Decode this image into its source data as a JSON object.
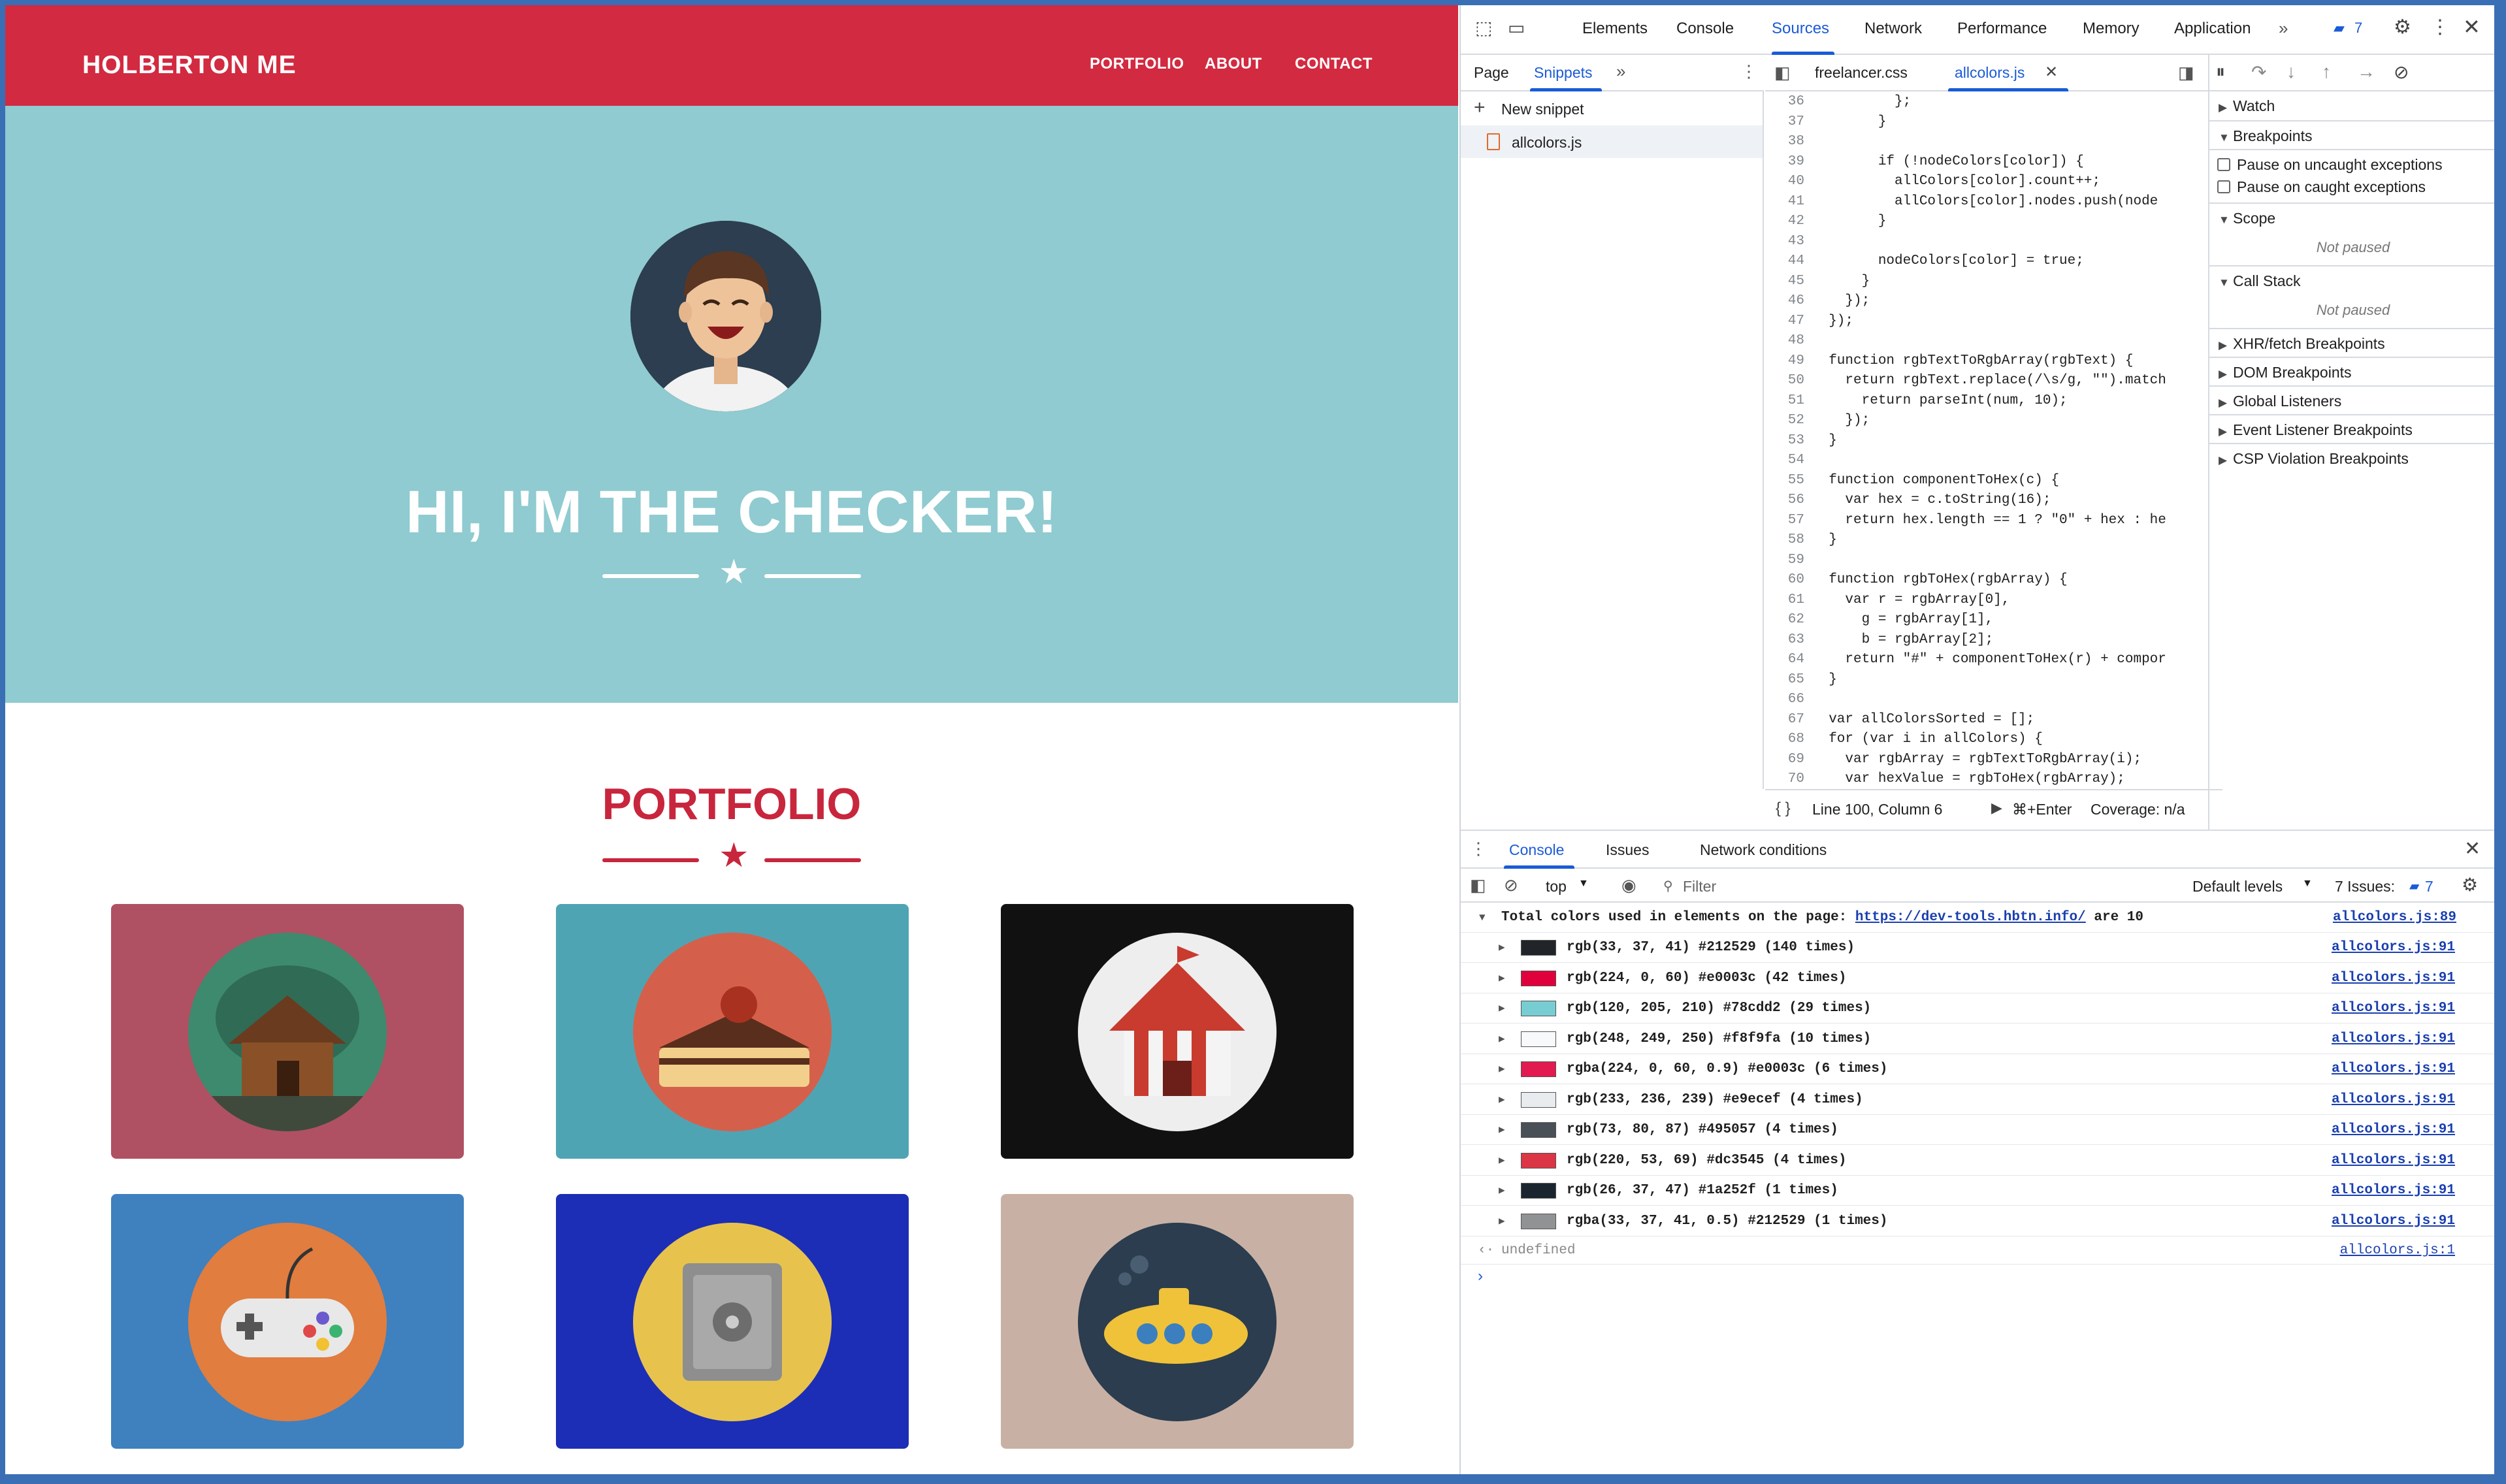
{
  "site": {
    "brand": "HOLBERTON ME",
    "nav": [
      "PORTFOLIO",
      "ABOUT",
      "CONTACT"
    ],
    "hero_title": "HI, I'M THE CHECKER!",
    "portfolio_title": "PORTFOLIO",
    "colors": {
      "navbar": "#d22a40",
      "hero": "#8fcbd0",
      "accent": "#c8263d"
    },
    "cards": [
      {
        "name": "cabin",
        "bg": "#b05063",
        "circle": "#3e8a6e"
      },
      {
        "name": "cake",
        "bg": "#4fa4b3",
        "circle": "#d4604b"
      },
      {
        "name": "circus",
        "bg": "#111111",
        "circle": "#eeeeee"
      },
      {
        "name": "game-controller",
        "bg": "#3f80bf",
        "circle": "#e07d3f"
      },
      {
        "name": "safe",
        "bg": "#1c2eb5",
        "circle": "#e7c34e"
      },
      {
        "name": "submarine",
        "bg": "#c8b1a4",
        "circle": "#2b3d4f"
      }
    ]
  },
  "devtools": {
    "tabs": [
      "Elements",
      "Console",
      "Sources",
      "Network",
      "Performance",
      "Memory",
      "Application"
    ],
    "active_tab": "Sources",
    "issues_badge": "7",
    "nav_tabs": [
      "Page",
      "Snippets"
    ],
    "new_snippet": "New snippet",
    "snippet_file": "allcolors.js",
    "editor_tabs": [
      "freelancer.css",
      "allcolors.js"
    ],
    "code_lines": [
      {
        "n": "36",
        "t": "          };"
      },
      {
        "n": "37",
        "t": "        }"
      },
      {
        "n": "38",
        "t": ""
      },
      {
        "n": "39",
        "t": "        if (!nodeColors[color]) {"
      },
      {
        "n": "40",
        "t": "          allColors[color].count++;"
      },
      {
        "n": "41",
        "t": "          allColors[color].nodes.push(node"
      },
      {
        "n": "42",
        "t": "        }"
      },
      {
        "n": "43",
        "t": ""
      },
      {
        "n": "44",
        "t": "        nodeColors[color] = true;"
      },
      {
        "n": "45",
        "t": "      }"
      },
      {
        "n": "46",
        "t": "    });"
      },
      {
        "n": "47",
        "t": "  });"
      },
      {
        "n": "48",
        "t": ""
      },
      {
        "n": "49",
        "t": "  function rgbTextToRgbArray(rgbText) {"
      },
      {
        "n": "50",
        "t": "    return rgbText.replace(/\\s/g, \"\").match"
      },
      {
        "n": "51",
        "t": "      return parseInt(num, 10);"
      },
      {
        "n": "52",
        "t": "    });"
      },
      {
        "n": "53",
        "t": "  }"
      },
      {
        "n": "54",
        "t": ""
      },
      {
        "n": "55",
        "t": "  function componentToHex(c) {"
      },
      {
        "n": "56",
        "t": "    var hex = c.toString(16);"
      },
      {
        "n": "57",
        "t": "    return hex.length == 1 ? \"0\" + hex : he"
      },
      {
        "n": "58",
        "t": "  }"
      },
      {
        "n": "59",
        "t": ""
      },
      {
        "n": "60",
        "t": "  function rgbToHex(rgbArray) {"
      },
      {
        "n": "61",
        "t": "    var r = rgbArray[0],"
      },
      {
        "n": "62",
        "t": "      g = rgbArray[1],"
      },
      {
        "n": "63",
        "t": "      b = rgbArray[2];"
      },
      {
        "n": "64",
        "t": "    return \"#\" + componentToHex(r) + compor"
      },
      {
        "n": "65",
        "t": "  }"
      },
      {
        "n": "66",
        "t": ""
      },
      {
        "n": "67",
        "t": "  var allColorsSorted = [];"
      },
      {
        "n": "68",
        "t": "  for (var i in allColors) {"
      },
      {
        "n": "69",
        "t": "    var rgbArray = rgbTextToRgbArray(i);"
      },
      {
        "n": "70",
        "t": "    var hexValue = rgbToHex(rgbArray);"
      }
    ],
    "status": {
      "position": "Line 100, Column 6",
      "run": "⌘+Enter",
      "coverage": "Coverage: n/a"
    },
    "right_pane": {
      "watch": "Watch",
      "breakpoints": "Breakpoints",
      "pause_uncaught": "Pause on uncaught exceptions",
      "pause_caught": "Pause on caught exceptions",
      "scope": "Scope",
      "not_paused": "Not paused",
      "call_stack": "Call Stack",
      "sections": [
        "XHR/fetch Breakpoints",
        "DOM Breakpoints",
        "Global Listeners",
        "Event Listener Breakpoints",
        "CSP Violation Breakpoints"
      ]
    },
    "console": {
      "tabs": [
        "Console",
        "Issues",
        "Network conditions"
      ],
      "context": "top",
      "filter_placeholder": "Filter",
      "levels": "Default levels",
      "issues_label": "7 Issues:",
      "issues_count": "7",
      "summary_prefix": "Total colors used in elements on the page:",
      "summary_link": "https://dev-tools.hbtn.info/",
      "summary_suffix": "are 10",
      "summary_src": "allcolors.js:89",
      "rows": [
        {
          "text": "rgb(33, 37, 41) #212529 (140 times)",
          "color": "#212529",
          "src": "allcolors.js:91"
        },
        {
          "text": "rgb(224, 0, 60) #e0003c (42 times)",
          "color": "#e0003c",
          "src": "allcolors.js:91"
        },
        {
          "text": "rgb(120, 205, 210) #78cdd2 (29 times)",
          "color": "#78cdd2",
          "src": "allcolors.js:91"
        },
        {
          "text": "rgb(248, 249, 250) #f8f9fa (10 times)",
          "color": "#f8f9fa",
          "src": "allcolors.js:91"
        },
        {
          "text": "rgba(224, 0, 60, 0.9) #e0003c (6 times)",
          "color": "#e21a4f",
          "src": "allcolors.js:91"
        },
        {
          "text": "rgb(233, 236, 239) #e9ecef (4 times)",
          "color": "#e9ecef",
          "src": "allcolors.js:91"
        },
        {
          "text": "rgb(73, 80, 87) #495057 (4 times)",
          "color": "#495057",
          "src": "allcolors.js:91"
        },
        {
          "text": "rgb(220, 53, 69) #dc3545 (4 times)",
          "color": "#dc3545",
          "src": "allcolors.js:91"
        },
        {
          "text": "rgb(26, 37, 47) #1a252f (1 times)",
          "color": "#1a252f",
          "src": "allcolors.js:91"
        },
        {
          "text": "rgba(33, 37, 41, 0.5) #212529 (1 times)",
          "color": "#909294",
          "src": "allcolors.js:91"
        }
      ],
      "result": "undefined",
      "result_src": "allcolors.js:1"
    }
  }
}
